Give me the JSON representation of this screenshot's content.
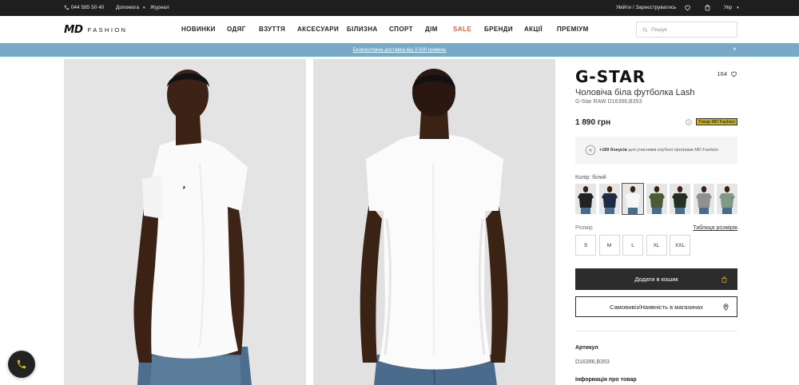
{
  "topbar": {
    "phone": "044 585 50 40",
    "help_label": "Допомога",
    "journal_label": "Журнал",
    "auth_label": "Увійти / Зареєструватись",
    "language": "Укр"
  },
  "header": {
    "logo_main": "MD",
    "logo_sub": "FASHION",
    "nav": [
      {
        "label": "НОВИНКИ",
        "sale": false
      },
      {
        "label": "ОДЯГ",
        "sale": false
      },
      {
        "label": "ВЗУТТЯ",
        "sale": false
      },
      {
        "label": "АКСЕСУАРИ",
        "sale": false
      },
      {
        "label": "БІЛИЗНА",
        "sale": false
      },
      {
        "label": "СПОРТ",
        "sale": false
      },
      {
        "label": "ДІМ",
        "sale": false
      },
      {
        "label": "SALE",
        "sale": true
      },
      {
        "label": "БРЕНДИ",
        "sale": false
      },
      {
        "label": "АКЦІЇ",
        "sale": false
      },
      {
        "label": "ПРЕМІУМ",
        "sale": false
      }
    ],
    "search_placeholder": "Пошук"
  },
  "promo": {
    "text": "Безкоштовна доставка від 3 500 гривень",
    "close_icon": "×"
  },
  "product": {
    "brand": "G-STAR",
    "likes": "164",
    "title": "Чоловіча біла футболка Lash",
    "subtitle": "G-Star RAW D16396,B353",
    "price": "1 890 грн",
    "md_badge": "Товар MD Fashion",
    "bonus_amount": "+189 бонусів",
    "bonus_text": " для учасників клубної програми MD Fashion",
    "color_label": "Колір:",
    "color_value": "білий",
    "swatches": [
      {
        "shirt": "#222222",
        "selected": false
      },
      {
        "shirt": "#1f2a44",
        "selected": false
      },
      {
        "shirt": "#f7f7f7",
        "selected": true
      },
      {
        "shirt": "#4d5a36",
        "selected": false
      },
      {
        "shirt": "#253025",
        "selected": false
      },
      {
        "shirt": "#8f918c",
        "selected": false
      },
      {
        "shirt": "#7f9a86",
        "selected": false
      }
    ],
    "swatch_next": "›",
    "size_label": "Розмір",
    "size_table_label": "Таблиця розмірів",
    "sizes": [
      "S",
      "M",
      "L",
      "XL",
      "XXL"
    ],
    "add_to_cart": "Додати в кошик",
    "pickup": "Самовивіз/Наявність в магазинах",
    "sku_label": "Артикул",
    "sku_value": "D16396,B353",
    "info_label": "Інформація про товар"
  },
  "colors": {
    "topbar_bg": "#1e1e1e",
    "promo_bg": "#78aac8",
    "sale": "#e0603a",
    "badge": "#c9b020",
    "button_dark": "#2c2c2c"
  }
}
